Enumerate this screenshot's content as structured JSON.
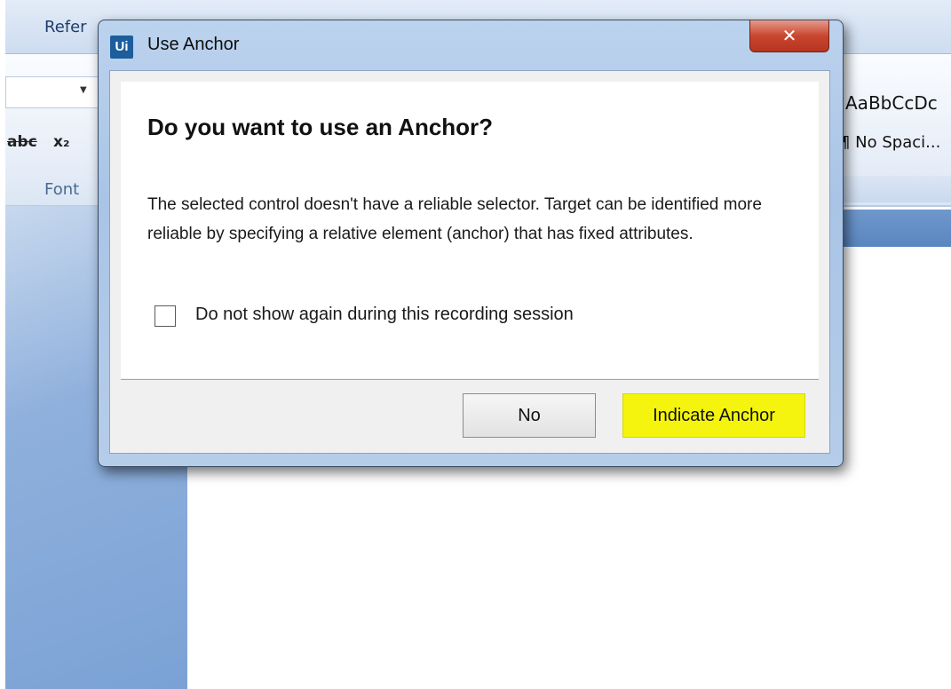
{
  "background_app": {
    "ribbon_tab": "Refer",
    "font_group_label": "Font",
    "strikethrough_label": "abc",
    "subscript_label": "x₂",
    "styles_preview": "AaBbCcDc",
    "style_name": "¶ No Spaci..."
  },
  "dialog": {
    "app_icon_text": "Ui",
    "title": "Use Anchor",
    "close_glyph": "✕",
    "heading": "Do you want to use an Anchor?",
    "message": "The selected control doesn't have a reliable selector. Target can be identified more reliable by specifying a relative element (anchor) that has fixed attributes.",
    "checkbox": {
      "label": "Do not show again during this recording session",
      "checked": false
    },
    "buttons": {
      "no": "No",
      "indicate": "Indicate Anchor"
    },
    "highlight_color": "#f4f40e"
  }
}
